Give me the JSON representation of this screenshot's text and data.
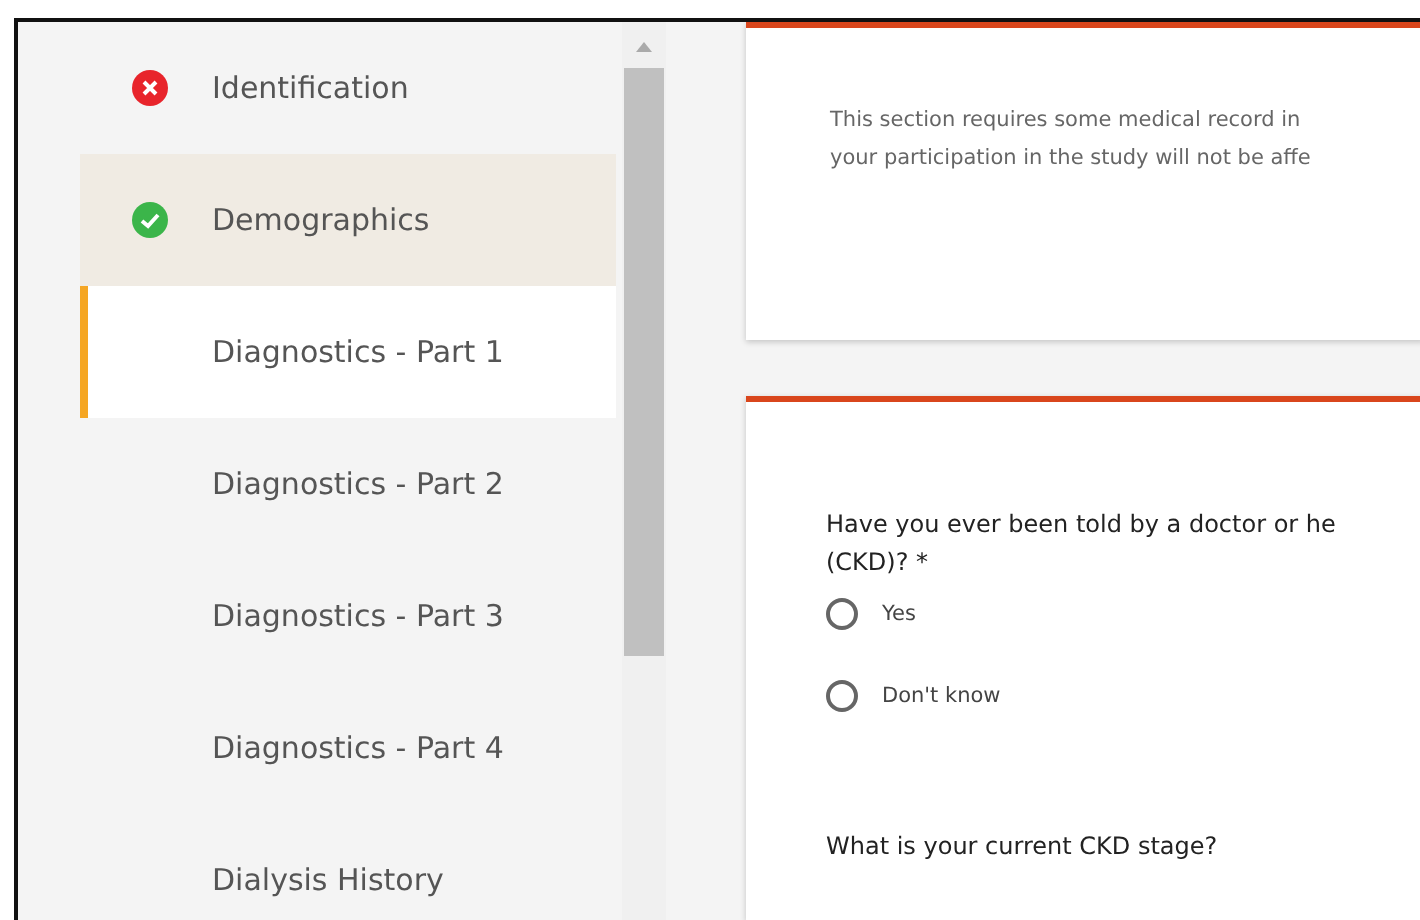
{
  "sidebar": {
    "items": [
      {
        "label": "Identification",
        "kind": "error",
        "selected": false,
        "hovered": false
      },
      {
        "label": "Demographics",
        "kind": "complete",
        "selected": false,
        "hovered": true
      },
      {
        "label": "Diagnostics - Part 1",
        "kind": "plain",
        "selected": true,
        "hovered": false
      },
      {
        "label": "Diagnostics - Part 2",
        "kind": "plain",
        "selected": false,
        "hovered": false
      },
      {
        "label": "Diagnostics - Part 3",
        "kind": "plain",
        "selected": false,
        "hovered": false
      },
      {
        "label": "Diagnostics - Part 4",
        "kind": "plain",
        "selected": false,
        "hovered": false
      },
      {
        "label": "Dialysis History",
        "kind": "plain",
        "selected": false,
        "hovered": false
      }
    ]
  },
  "intro_card": {
    "lines": [
      "This section requires some medical record in",
      "your participation in the study will not be affe"
    ]
  },
  "question_card": {
    "question_lines": [
      "Have you ever been told by a doctor or he",
      "(CKD)? *"
    ],
    "options": [
      {
        "label": "Yes",
        "selected": false
      },
      {
        "label": "Don't know",
        "selected": false
      }
    ],
    "next_question": "What is your current CKD stage?"
  }
}
